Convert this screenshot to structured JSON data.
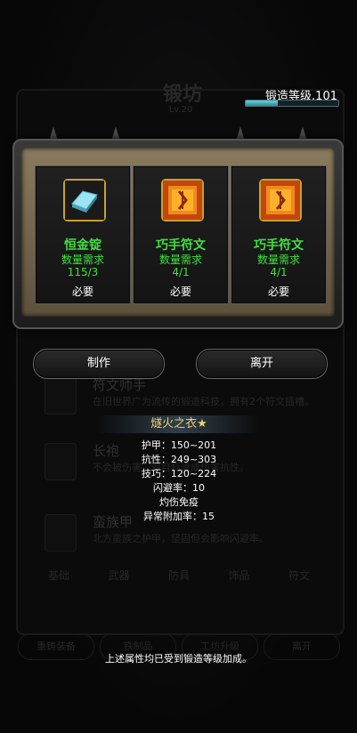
{
  "background": {
    "title": "锻坊",
    "subtitle": "Lv.20",
    "rows": [
      {
        "name": "符文师手",
        "desc": "在旧世界广为流传的锻造科技，拥有2个符文插槽。"
      },
      {
        "name": "长袍",
        "desc": "不会被伤害，对目标造成伤害抗性。"
      },
      {
        "name": "蛮族甲",
        "desc": "北方蛮族之护甲，坚固但会影响闪避率。"
      }
    ],
    "tabs": [
      "基础",
      "武器",
      "防具",
      "饰品",
      "符文"
    ],
    "buttons": [
      "重铸装备",
      "铁制品",
      "工坊升级",
      "离开"
    ]
  },
  "forge": {
    "label": "锻造等级.101",
    "progress": 0.35,
    "bar_color": "#4fc3d0"
  },
  "materials": [
    {
      "name": "恒金锭",
      "req_label": "数量需求",
      "count": "115/3",
      "status": "必要",
      "icon": "silver-ingot-icon"
    },
    {
      "name": "巧手符文",
      "req_label": "数量需求",
      "count": "4/1",
      "status": "必要",
      "icon": "orange-rune-icon"
    },
    {
      "name": "巧手符文",
      "req_label": "数量需求",
      "count": "4/1",
      "status": "必要",
      "icon": "orange-rune-icon"
    }
  ],
  "buttons": {
    "craft": "制作",
    "leave": "离开"
  },
  "item": {
    "title": "燧火之衣★",
    "stats": [
      "护甲：150~201",
      "抗性：249~303",
      "技巧：120~224",
      "闪避率：10",
      "灼伤免疫",
      "异常附加率：15"
    ]
  },
  "note": "上述属性均已受到锻造等级加成。"
}
